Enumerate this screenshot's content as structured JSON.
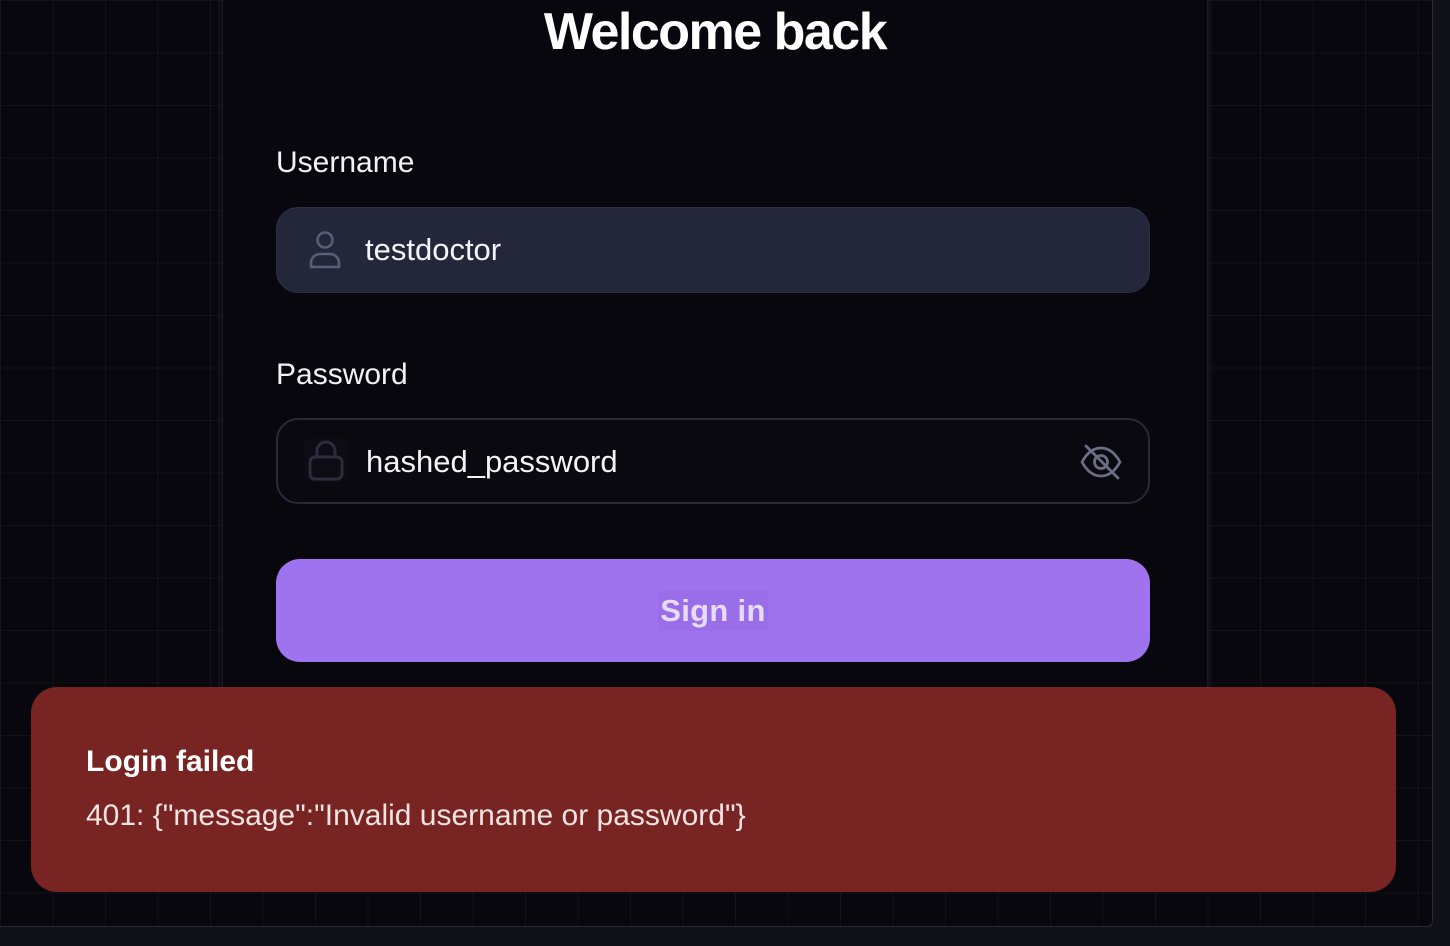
{
  "page": {
    "title": "Welcome back"
  },
  "form": {
    "username": {
      "label": "Username",
      "value": "testdoctor",
      "icon": "user-icon"
    },
    "password": {
      "label": "Password",
      "value": "hashed_password",
      "icon": "lock-icon",
      "toggle_icon": "eye-off-icon"
    },
    "submit_label": "Sign in"
  },
  "toast": {
    "title": "Login failed",
    "description": "401: {\"message\":\"Invalid username or password\"}"
  },
  "colors": {
    "background": "#08070d",
    "input_bg": "#242639",
    "accent": "#a073ee",
    "error": "#772422"
  }
}
